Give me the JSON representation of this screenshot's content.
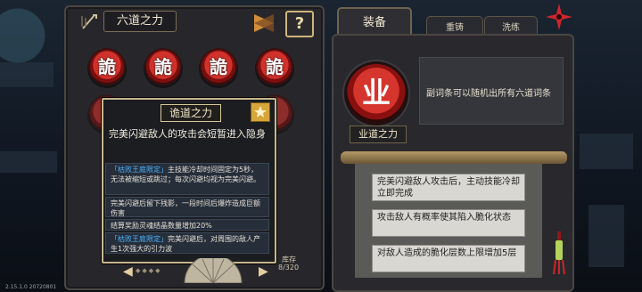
{
  "left_panel": {
    "title": "六道之力",
    "help_label": "?",
    "medals": [
      "詭",
      "詭",
      "詭",
      "詭"
    ],
    "stock_label": "库存",
    "stock_value": "8/320"
  },
  "popup": {
    "title": "诡道之力",
    "description": "完美闪避敌人的攻击会短暂进入隐身",
    "effects": [
      {
        "tag": "「枯败王庭限定」",
        "text": "主技能冷却时间固定为5秒，无法被缩短或跳过；每次闪避均视为完美闪避。"
      },
      {
        "tag": "",
        "text": "完美闪避后留下残影，一段时间后爆炸造成巨额伤害"
      },
      {
        "tag": "",
        "text": "结算奖励灵魂结晶数量增加20%"
      },
      {
        "tag": "「枯败王庭限定」",
        "text": "完美闪避后，对周围的敌人产生1次强大的引力波"
      }
    ]
  },
  "right_panel": {
    "tabs": [
      "装备",
      "重铸",
      "洗练"
    ],
    "emblem_glyph": "业",
    "emblem_name": "业道之力",
    "affix_text": "副词条可以随机出所有六道词条",
    "effects": [
      "完美闪避敌人攻击后，主动技能冷却立即完成",
      "攻击敌人有概率使其陷入脆化状态",
      "对敌人造成的脆化层数上限增加5层"
    ]
  },
  "version_text": "2.15.1.0 20720801",
  "colors": {
    "accent_gold": "#c7b68e",
    "emblem_red": "#d5352c",
    "tag_blue": "#4cb3ff"
  }
}
